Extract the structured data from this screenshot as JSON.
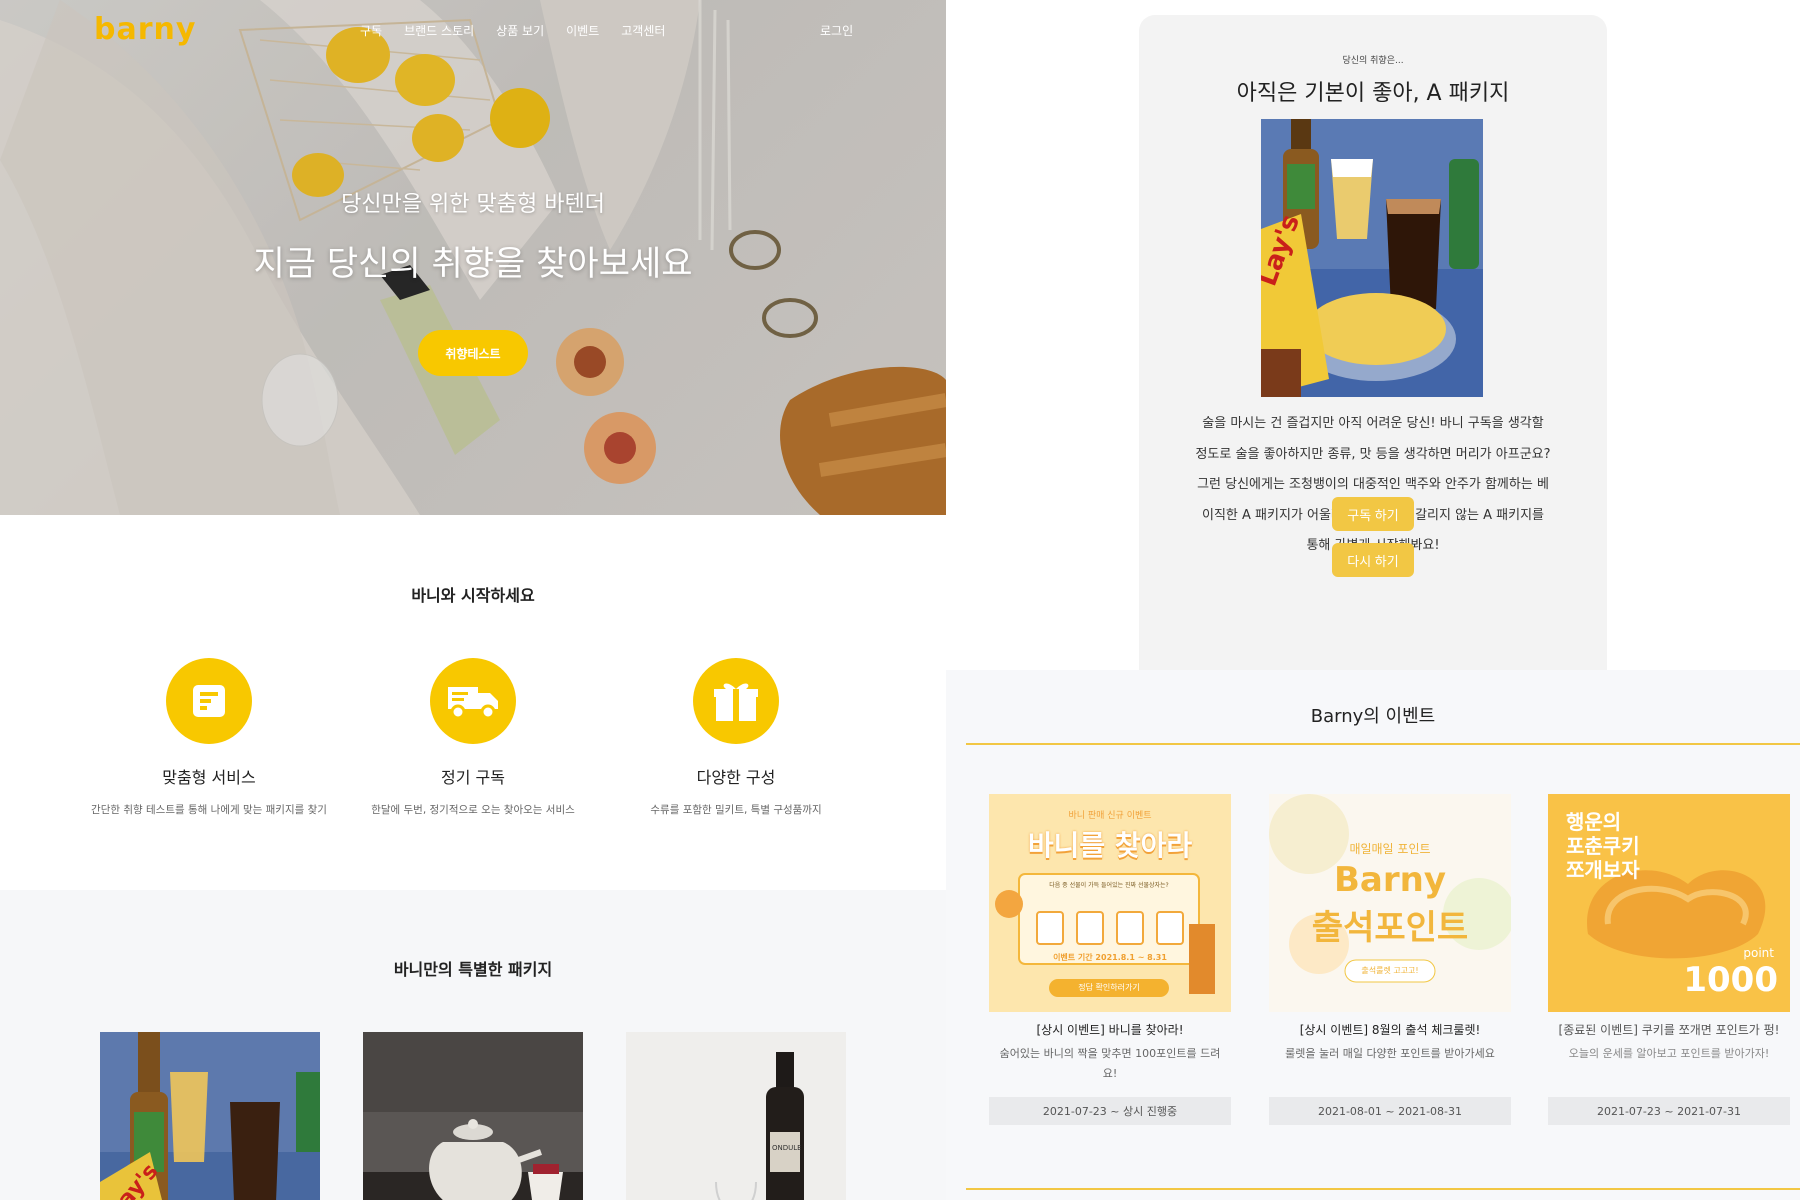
{
  "nav": {
    "logo": "barny",
    "menu": [
      "구독",
      "브랜드 스토리",
      "상품 보기",
      "이벤트",
      "고객센터"
    ],
    "login": "로그인"
  },
  "hero": {
    "subtitle": "당신만을 위한 맞춤형 바텐더",
    "title": "지금 당신의 취향을 찾아보세요",
    "button": "취향테스트"
  },
  "start": {
    "title": "바니와 시작하세요",
    "features": [
      {
        "icon": "document-icon",
        "title": "맞춤형 서비스",
        "desc": "간단한 취향 테스트를 통해 나에게 맞는 패키지를 찾기"
      },
      {
        "icon": "delivery-truck-icon",
        "title": "정기 구독",
        "desc": "한달에 두번, 정기적으로 오는 찾아오는 서비스"
      },
      {
        "icon": "gift-icon",
        "title": "다양한 구성",
        "desc": "수류를 포함한 밀키트, 특별 구성품까지"
      }
    ]
  },
  "packages": {
    "title": "바니만의 특별한 패키지"
  },
  "result": {
    "small": "당신의 취향은...",
    "title": "아직은 기본이 좋아, A 패키지",
    "text": "술을 마시는 건 즐겁지만 아직 어려운 당신! 바니 구독을 생각할 정도로 술을 좋아하지만 종류, 맛 등을 생각하면 머리가 아프군요? 그런 당신에게는 조청뱅이의 대중적인 맥주와 안주가 함께하는 베이직한 A 패키지가 어울려요. 호불호가 갈리지 않는 A 패키지를 통해 가볍게 시작해봐요!",
    "subscribe_button": "구독 하기",
    "retry_button": "다시 하기"
  },
  "events": {
    "title": "Barny의 이벤트",
    "items": [
      {
        "banner_small": "바니 판매 신규 이벤트",
        "banner_big": "바니를 찾아라",
        "banner_caption": "다음 중 선물이 가득 들어있는 진짜 선물상자는?",
        "banner_period": "이벤트 기간 2021.8.1 ~ 8.31",
        "banner_button": "정답 확인하러가기",
        "name": "[상시 이벤트] 바니를 찾아라!",
        "desc": "숨어있는 바니의 짝을 맞추면 100포인트를 드려요!",
        "date": "2021-07-23 ~ 상시 진행중"
      },
      {
        "banner_small": "매일매일 포인트",
        "banner_big1": "Barny",
        "banner_big2": "출석포인트",
        "banner_button": "출석룰렛 고고고!",
        "name": "[상시 이벤트] 8월의 출석 체크룰렛!",
        "desc": "룰렛을 눌러 매일 다양한 포인트를 받아가세요",
        "date": "2021-08-01 ~ 2021-08-31"
      },
      {
        "banner_big1": "행운의",
        "banner_big2": "포춘쿠키",
        "banner_big3": "쪼개보자",
        "banner_point_label": "point",
        "banner_point": "1000",
        "name": "[종료된 이벤트] 쿠키를 쪼개면 포인트가 펑!",
        "desc": "오늘의 운세를 알아보고 포인트를 받아가자!",
        "date": "2021-07-23 ~ 2021-07-31"
      }
    ]
  },
  "colors": {
    "accent": "#f8c800",
    "button_soft": "#f2c744",
    "card_bg": "#f3f3f3",
    "section_bg": "#f6f7f9"
  }
}
